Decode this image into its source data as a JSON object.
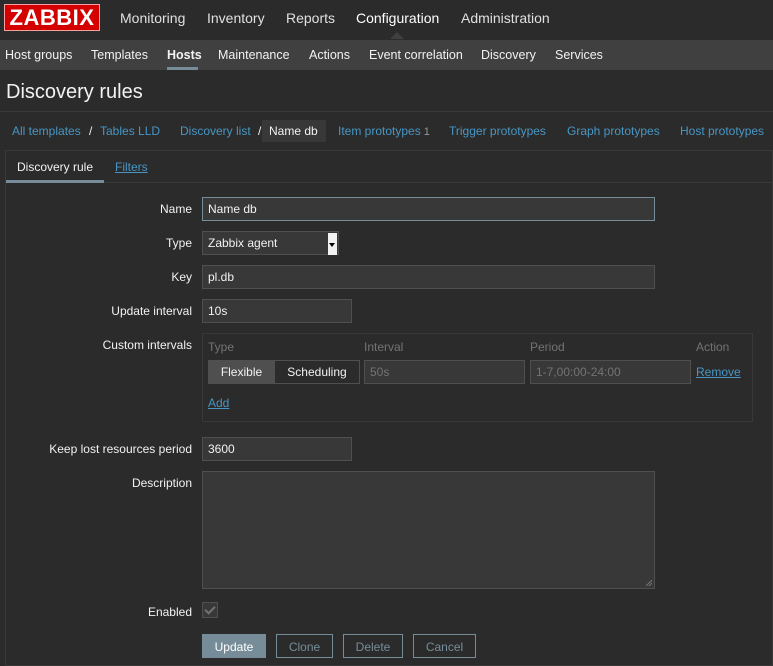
{
  "logo": "ZABBIX",
  "top_nav": [
    "Monitoring",
    "Inventory",
    "Reports",
    "Configuration",
    "Administration"
  ],
  "top_nav_active": "Configuration",
  "sub_nav": [
    "Host groups",
    "Templates",
    "Hosts",
    "Maintenance",
    "Actions",
    "Event correlation",
    "Discovery",
    "Services"
  ],
  "sub_nav_active": "Hosts",
  "page_title": "Discovery rules",
  "breadcrumb": {
    "all_templates": "All templates",
    "sep": "/",
    "template": "Tables LLD",
    "discovery_list": "Discovery list",
    "current": "Name db",
    "item_prototypes": "Item prototypes",
    "item_prototypes_count": "1",
    "trigger_prototypes": "Trigger prototypes",
    "graph_prototypes": "Graph prototypes",
    "host_prototypes": "Host prototypes"
  },
  "tabs": {
    "discovery_rule": "Discovery rule",
    "filters": "Filters"
  },
  "form": {
    "name_label": "Name",
    "name_value": "Name db",
    "type_label": "Type",
    "type_value": "Zabbix agent",
    "key_label": "Key",
    "key_value": "pl.db",
    "update_interval_label": "Update interval",
    "update_interval_value": "10s",
    "custom_intervals_label": "Custom intervals",
    "custom_intervals": {
      "col_type": "Type",
      "col_interval": "Interval",
      "col_period": "Period",
      "col_action": "Action",
      "flexible": "Flexible",
      "scheduling": "Scheduling",
      "interval_value": "50s",
      "period_value": "1-7,00:00-24:00",
      "remove": "Remove",
      "add": "Add"
    },
    "keep_lost_label": "Keep lost resources period",
    "keep_lost_value": "3600",
    "description_label": "Description",
    "description_value": "",
    "enabled_label": "Enabled",
    "enabled": true
  },
  "buttons": {
    "update": "Update",
    "clone": "Clone",
    "delete": "Delete",
    "cancel": "Cancel"
  }
}
